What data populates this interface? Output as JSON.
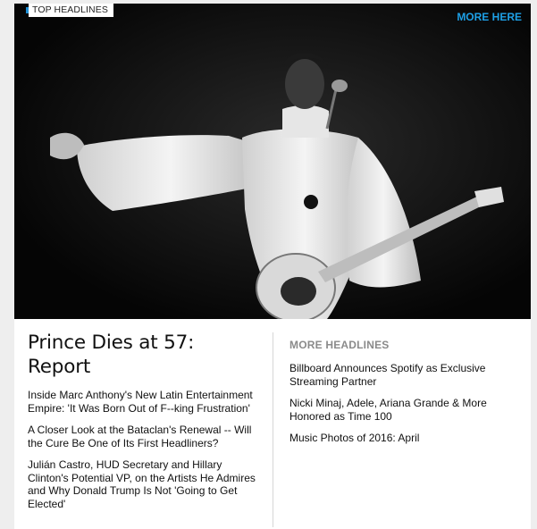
{
  "widget": {
    "tag_label": "TOP HEADLINES",
    "more_here_label": "MORE HERE",
    "accent_color": "#1ea0e6"
  },
  "hero": {
    "photo_subject": "prince-performing-photo"
  },
  "main_story": {
    "headline": "Prince Dies at 57: Report",
    "sub_headlines": [
      "Inside Marc Anthony's New Latin Entertainment Empire: 'It Was Born Out of F--king Frustration'",
      "A Closer Look at the Bataclan's Renewal -- Will the Cure Be One of Its First Headliners?",
      "Julián Castro, HUD Secretary and Hillary Clinton's Potential VP, on the Artists He Admires and Why Donald Trump Is Not 'Going to Get Elected'"
    ]
  },
  "more_headlines": {
    "title": "MORE HEADLINES",
    "items": [
      "Billboard Announces Spotify as Exclusive Streaming Partner",
      "Nicki Minaj, Adele, Ariana Grande & More Honored as Time 100",
      "Music Photos of 2016: April"
    ]
  }
}
